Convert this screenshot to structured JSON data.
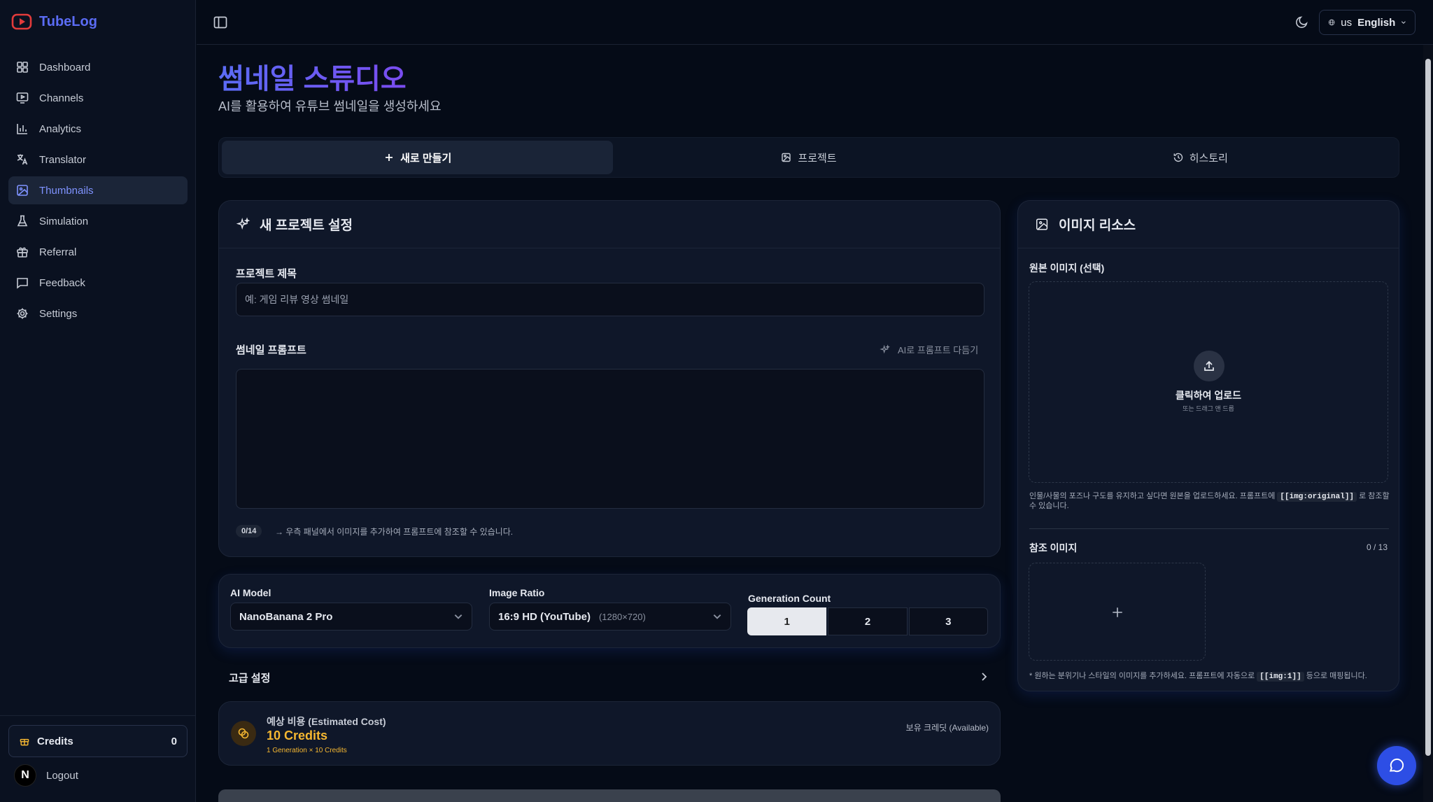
{
  "brand": {
    "name": "TubeLog",
    "accent": "#5b6cf5"
  },
  "sidebar": {
    "items": [
      {
        "label": "Dashboard",
        "icon": "grid-icon"
      },
      {
        "label": "Channels",
        "icon": "monitor-play-icon"
      },
      {
        "label": "Analytics",
        "icon": "bar-chart-icon"
      },
      {
        "label": "Translator",
        "icon": "languages-icon"
      },
      {
        "label": "Thumbnails",
        "icon": "image-icon",
        "active": true
      },
      {
        "label": "Simulation",
        "icon": "flask-icon"
      },
      {
        "label": "Referral",
        "icon": "gift-icon"
      },
      {
        "label": "Feedback",
        "icon": "message-square-icon"
      },
      {
        "label": "Settings",
        "icon": "gear-icon"
      }
    ],
    "credits_label": "Credits",
    "credits_value": "0",
    "avatar_letter": "N",
    "logout_label": "Logout"
  },
  "topbar": {
    "lang_prefix": "us",
    "lang_label": "English"
  },
  "page": {
    "title": "썸네일 스튜디오",
    "subtitle": "AI를 활용하여 유튜브 썸네일을 생성하세요"
  },
  "tabs": [
    {
      "label": "새로 만들기",
      "icon": "plus-icon",
      "active": true
    },
    {
      "label": "프로젝트",
      "icon": "image-edit-icon"
    },
    {
      "label": "히스토리",
      "icon": "history-icon"
    }
  ],
  "project": {
    "heading": "새 프로젝트 설정",
    "title_label": "프로젝트 제목",
    "title_placeholder": "예: 게임 리뷰 영상 썸네일",
    "prompt_label": "썸네일 프롬프트",
    "ai_refine_label": "AI로 프롬프트 다듬기",
    "prompt_value": "",
    "counter": "0/14",
    "helper": "→ 우측 패널에서 이미지를 추가하여 프롬프트에 참조할 수 있습니다."
  },
  "generation": {
    "model_label": "AI Model",
    "model_value": "NanoBanana 2 Pro",
    "ratio_label": "Image Ratio",
    "ratio_value": "16:9 HD (YouTube)",
    "ratio_detail": "(1280×720)",
    "count_label": "Generation Count",
    "counts": [
      "1",
      "2",
      "3"
    ],
    "selected_count": "1",
    "advanced_label": "고급 설정"
  },
  "cost": {
    "label": "예상 비용 (Estimated Cost)",
    "value": "10 Credits",
    "detail": "1 Generation × 10 Credits",
    "available_label": "보유 크레딧 (Available)",
    "accent": "#f5b731"
  },
  "resources": {
    "heading": "이미지 리소스",
    "original_label": "원본 이미지 (선택)",
    "upload_label": "클릭하여 업로드",
    "upload_sub": "또는 드래그 앤 드롭",
    "original_note_pre": "인물/사물의 포즈나 구도를 유지하고 싶다면 원본을 업로드하세요. 프롬프트에",
    "original_code": "[[img:original]]",
    "original_note_post": "로 참조할 수 있습니다.",
    "ref_label": "참조 이미지",
    "ref_count": "0 / 13",
    "ref_note_pre": "* 원하는 분위기나 스타일의 이미지를 추가하세요. 프롬프트에 자동으로",
    "ref_code": "[[img:1]]",
    "ref_note_post": "등으로 매핑됩니다."
  }
}
